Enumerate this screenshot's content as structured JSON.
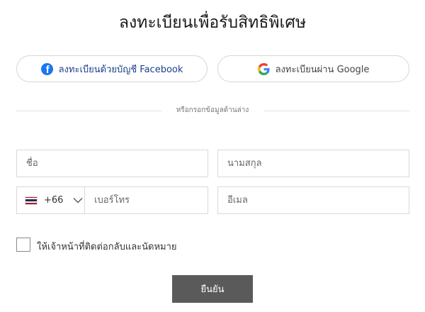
{
  "title": "ลงทะเบียนเพื่อรับสิทธิพิเศษ",
  "social": {
    "facebook_label": "ลงทะเบียนด้วยบัญชี Facebook",
    "google_label": "ลงทะเบียนผ่าน Google"
  },
  "divider_text": "หรือกรอกข้อมูลด้านล่าง",
  "form": {
    "first_name_placeholder": "ชื่อ",
    "last_name_placeholder": "นามสกุล",
    "country_code": "+66",
    "phone_placeholder": "เบอร์โทร",
    "email_placeholder": "อีเมล"
  },
  "consent_label": "ให้เจ้าหน้าที่ติดต่อกลับและนัดหมาย",
  "submit_label": "ยืนยัน",
  "icons": {
    "facebook": "facebook-icon",
    "google": "google-icon",
    "flag": "thailand-flag-icon",
    "chevron": "chevron-down-icon"
  },
  "colors": {
    "facebook_blue": "#1877f2",
    "facebook_text": "#1c3f8c",
    "submit_bg": "#5a5a5a",
    "border": "#d9d9d9"
  }
}
